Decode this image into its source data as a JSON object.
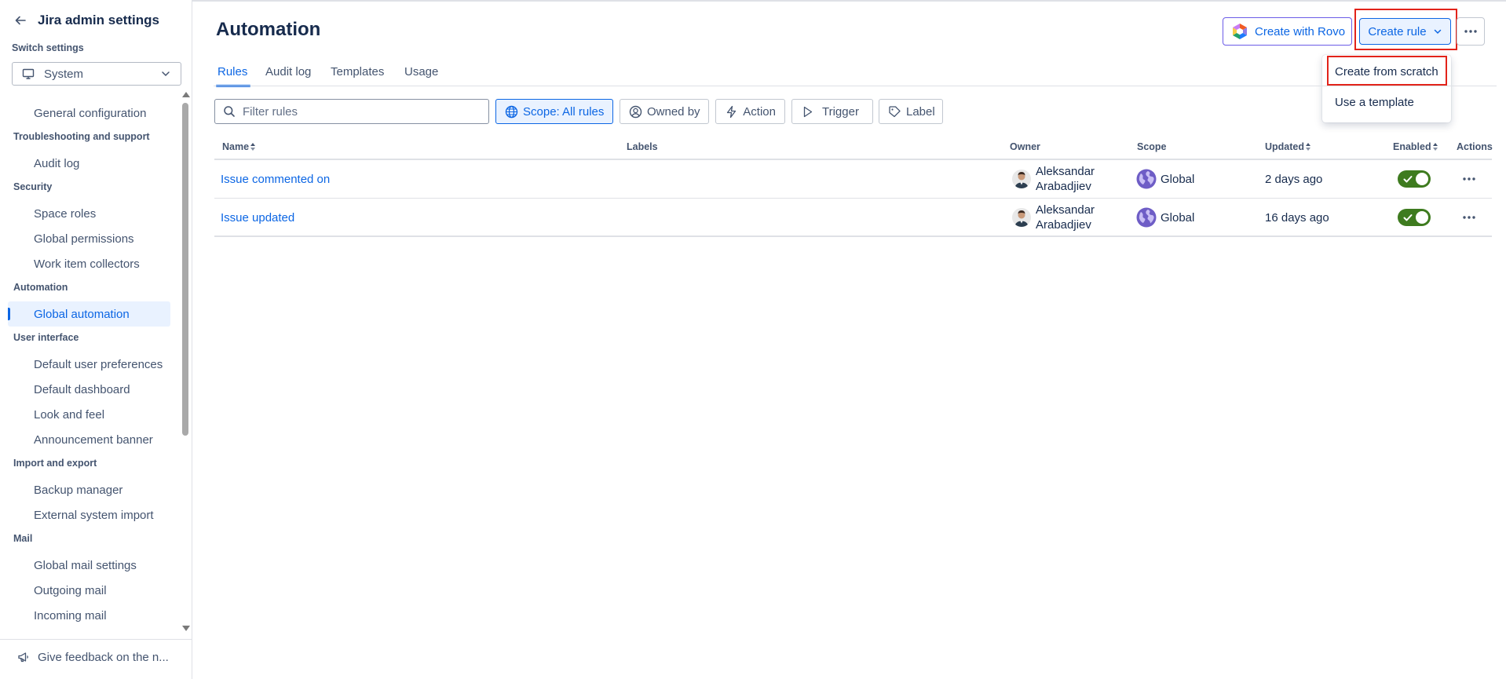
{
  "sidebar": {
    "title": "Jira admin settings",
    "switch_label": "Switch settings",
    "switch_value": "System",
    "items": {
      "general_configuration": "General configuration",
      "section_troubleshooting": "Troubleshooting and support",
      "audit_log": "Audit log",
      "section_security": "Security",
      "space_roles": "Space roles",
      "global_permissions": "Global permissions",
      "work_item_collectors": "Work item collectors",
      "section_automation": "Automation",
      "global_automation": "Global automation",
      "section_user_interface": "User interface",
      "default_user_preferences": "Default user preferences",
      "default_dashboard": "Default dashboard",
      "look_and_feel": "Look and feel",
      "announcement_banner": "Announcement banner",
      "section_import_export": "Import and export",
      "backup_manager": "Backup manager",
      "external_system_import": "External system import",
      "section_mail": "Mail",
      "global_mail_settings": "Global mail settings",
      "outgoing_mail": "Outgoing mail",
      "incoming_mail": "Incoming mail"
    },
    "feedback": "Give feedback on the n..."
  },
  "header": {
    "title": "Automation",
    "create_with_rovo": "Create with Rovo",
    "create_rule": "Create rule"
  },
  "dropdown": {
    "create_from_scratch": "Create from scratch",
    "use_template": "Use a template"
  },
  "tabs": {
    "rules": "Rules",
    "audit_log": "Audit log",
    "templates": "Templates",
    "usage": "Usage"
  },
  "filters": {
    "search_placeholder": "Filter rules",
    "scope": "Scope: All rules",
    "owned_by": "Owned by",
    "action": "Action",
    "trigger": "Trigger",
    "label": "Label"
  },
  "table": {
    "headers": {
      "name": "Name",
      "labels": "Labels",
      "owner": "Owner",
      "scope": "Scope",
      "updated": "Updated",
      "enabled": "Enabled",
      "actions": "Actions"
    },
    "rows": [
      {
        "name": "Issue commented on",
        "owner_first": "Aleksandar",
        "owner_last": "Arabadjiev",
        "scope": "Global",
        "updated": "2 days ago",
        "enabled": true
      },
      {
        "name": "Issue updated",
        "owner_first": "Aleksandar",
        "owner_last": "Arabadjiev",
        "scope": "Global",
        "updated": "16 days ago",
        "enabled": true
      }
    ]
  },
  "colors": {
    "accent": "#0c66e4",
    "highlight_box": "#e2231a",
    "toggle_on": "#3e7b1f",
    "rovo_border": "#6b5ce7"
  },
  "icons": [
    "arrow-left-icon",
    "monitor-icon",
    "chevron-down-icon",
    "megaphone-icon",
    "rovo-icon",
    "more-icon",
    "search-icon",
    "globe-icon",
    "user-circle-icon",
    "lightning-icon",
    "play-icon",
    "tag-icon",
    "avatar",
    "globe-scope-icon",
    "check-icon"
  ]
}
